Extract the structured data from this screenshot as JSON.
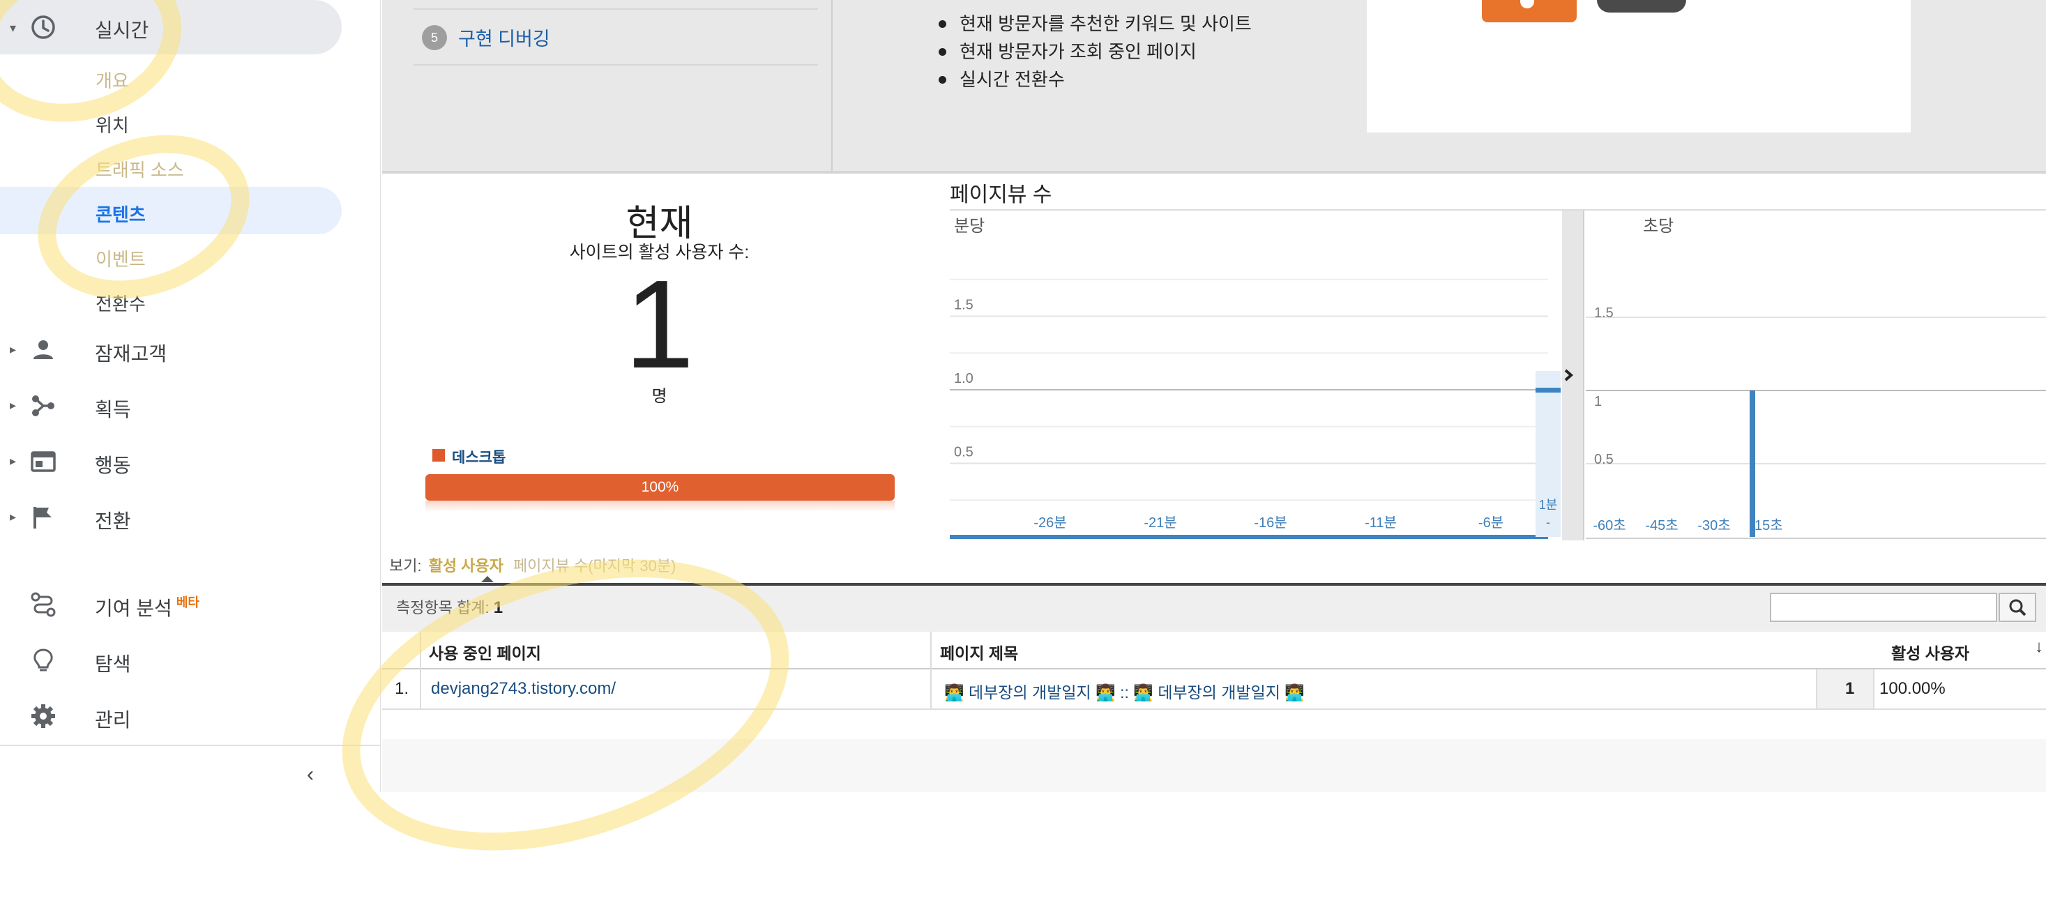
{
  "sidebar": {
    "realtime": {
      "label": "실시간"
    },
    "realtime_items": [
      {
        "label": "개요"
      },
      {
        "label": "위치"
      },
      {
        "label": "트래픽 소스"
      },
      {
        "label": "콘텐츠"
      },
      {
        "label": "이벤트"
      },
      {
        "label": "전환수"
      }
    ],
    "sections": [
      {
        "label": "잠재고객",
        "icon": "person-icon"
      },
      {
        "label": "획득",
        "icon": "acquisition-icon"
      },
      {
        "label": "행동",
        "icon": "behavior-icon"
      },
      {
        "label": "전환",
        "icon": "flag-icon"
      }
    ],
    "attribution": {
      "label": "기여 분석",
      "badge": "베타"
    },
    "discover": {
      "label": "탐색"
    },
    "admin": {
      "label": "관리"
    }
  },
  "setup_steps": [
    {
      "num": "5",
      "label": "구현 디버깅"
    }
  ],
  "feature_list": [
    "현재 방문자를 추천한 키워드 및 사이트",
    "현재 방문자가 조회 중인 페이지",
    "실시간 전환수"
  ],
  "current": {
    "heading": "현재",
    "subtitle": "사이트의 활성 사용자 수:",
    "count": "1",
    "unit": "명",
    "device_label": "데스크톱",
    "device_percent": "100%",
    "device_share": 1.0
  },
  "pageviews": {
    "title": "페이지뷰 수",
    "per_minute_label": "분당",
    "per_second_label": "초당"
  },
  "chart_data": [
    {
      "type": "bar",
      "title": "분당",
      "x_ticks": [
        "-26분",
        "-21분",
        "-16분",
        "-11분",
        "-6분",
        "1분"
      ],
      "x_ticks_sub": [
        "",
        "",
        "",
        "",
        "",
        "-"
      ],
      "y_ticks": [
        "0.5",
        "1.0",
        "1.5"
      ],
      "ylim": [
        0,
        2
      ],
      "categories": [
        "-1분"
      ],
      "values": [
        1
      ],
      "color": "#3f84c1"
    },
    {
      "type": "bar",
      "title": "초당",
      "x_ticks": [
        "-60초",
        "-45초",
        "-30초",
        "-15초"
      ],
      "y_ticks": [
        "0.5",
        "1",
        "1.5"
      ],
      "ylim": [
        0,
        2
      ],
      "categories": [
        "-19초"
      ],
      "values": [
        1
      ],
      "color": "#3f84c1"
    }
  ],
  "view": {
    "label": "보기:",
    "active": "활성 사용자",
    "other": "페이지뷰 수(마지막 30분)"
  },
  "table": {
    "metric_total_label": "측정항목 합계:",
    "metric_total_value": "1",
    "search_placeholder": "",
    "headers": [
      "사용 중인 페이지",
      "페이지 제목",
      "활성 사용자"
    ],
    "rows": [
      {
        "index": "1.",
        "page": "devjang2743.tistory.com/",
        "title": "👨‍💻 데부장의 개발일지 👨‍💻 :: 👨‍💻 데부장의 개발일지 👨‍💻",
        "value": "1",
        "percent": "100.00%"
      }
    ]
  },
  "colors": {
    "accent": "#1a73e8",
    "device": "#e06030",
    "chart": "#3f84c1"
  }
}
